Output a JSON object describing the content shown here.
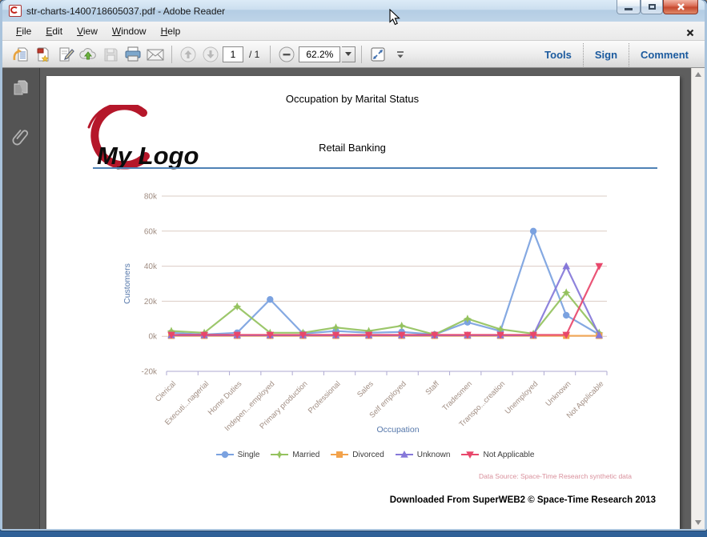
{
  "window": {
    "title": "str-charts-1400718605037.pdf - Adobe Reader"
  },
  "menu": {
    "items": [
      "File",
      "Edit",
      "View",
      "Window",
      "Help"
    ]
  },
  "toolbar": {
    "page_current": "1",
    "page_total": "/ 1",
    "zoom": "62.2%",
    "tools": "Tools",
    "sign": "Sign",
    "comment": "Comment"
  },
  "page": {
    "title": "Occupation by Marital Status",
    "subtitle": "Retail Banking",
    "logo_text": "My Logo",
    "data_source": "Data Source: Space-Time Research synthetic data",
    "footer": "Downloaded From SuperWEB2 © Space-Time Research 2013"
  },
  "chart_data": {
    "type": "line",
    "title": "Occupation by Marital Status",
    "xlabel": "Occupation",
    "ylabel": "Customers",
    "ylim": [
      -20000,
      80000
    ],
    "y_ticks": [
      "80k",
      "60k",
      "40k",
      "20k",
      "0k",
      "-20k"
    ],
    "grid": true,
    "legend_position": "bottom",
    "categories": [
      "Clerical",
      "Executi...nagerial",
      "Home Duties",
      "Indepen...employed",
      "Primary production",
      "Professional",
      "Sales",
      "Self employed",
      "Staff",
      "Tradesmen",
      "Transpo...creation",
      "Unemployed",
      "Unknown",
      "Not Applicable"
    ],
    "series": [
      {
        "name": "Single",
        "color": "#7ba2e0",
        "marker": "circle",
        "values": [
          2000,
          1000,
          2000,
          21000,
          1500,
          3000,
          2000,
          2500,
          1000,
          8000,
          3000,
          60000,
          12000,
          1000
        ]
      },
      {
        "name": "Married",
        "color": "#94c25e",
        "marker": "star",
        "values": [
          3000,
          2000,
          17000,
          2000,
          2000,
          5000,
          3000,
          6000,
          1000,
          10000,
          4000,
          1500,
          25000,
          2000
        ]
      },
      {
        "name": "Divorced",
        "color": "#f2a24b",
        "marker": "square",
        "values": [
          300,
          300,
          300,
          300,
          300,
          300,
          300,
          300,
          300,
          300,
          300,
          300,
          300,
          300
        ]
      },
      {
        "name": "Unknown",
        "color": "#8678d9",
        "marker": "triangle-up",
        "values": [
          600,
          600,
          600,
          600,
          600,
          600,
          600,
          600,
          600,
          600,
          600,
          600,
          40000,
          600
        ]
      },
      {
        "name": "Not Applicable",
        "color": "#e8476b",
        "marker": "triangle-down",
        "values": [
          800,
          800,
          800,
          800,
          800,
          800,
          800,
          800,
          800,
          800,
          800,
          800,
          800,
          40000
        ]
      }
    ]
  },
  "colors": {
    "grid": "#dbccc4",
    "axis_line": "#aeaad2",
    "tick_text": "#a08d82",
    "axis_title": "#5577aa",
    "accent_blue": "#1b5a9e",
    "logo_red": "#b5172a",
    "rule_blue": "#4f81b5"
  }
}
